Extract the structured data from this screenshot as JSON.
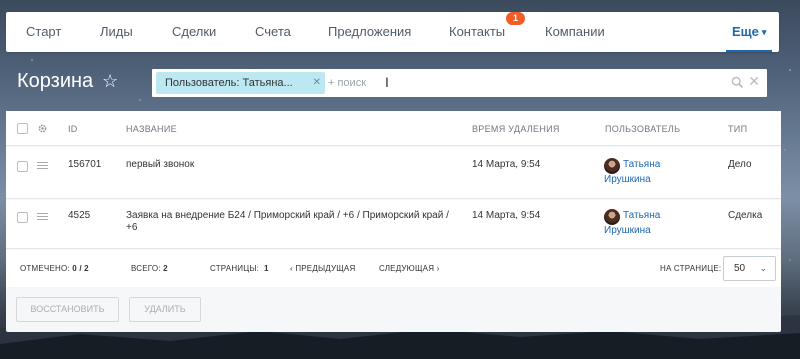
{
  "nav": {
    "items": [
      "Старт",
      "Лиды",
      "Сделки",
      "Счета",
      "Предложения",
      "Контакты",
      "Компании"
    ],
    "contacts_badge": "1",
    "more_label": "Еще"
  },
  "page": {
    "title": "Корзина"
  },
  "search": {
    "filter_chip": "Пользователь: Татьяна...",
    "add_label": "+ поиск"
  },
  "table": {
    "headers": {
      "id": "ID",
      "name": "НАЗВАНИЕ",
      "deleted": "ВРЕМЯ УДАЛЕНИЯ",
      "user": "ПОЛЬЗОВАТЕЛЬ",
      "type": "ТИП"
    },
    "rows": [
      {
        "id": "156701",
        "name": "первый звонок",
        "deleted": "14 Марта, 9:54",
        "user_first": "Татьяна",
        "user_last": "Ирушкина",
        "type": "Дело"
      },
      {
        "id": "4525",
        "name": "Заявка на внедрение Б24 / Приморский край / +6 / Приморский край / +6",
        "deleted": "14 Марта, 9:54",
        "user_first": "Татьяна",
        "user_last": "Ирушкина",
        "type": "Сделка"
      }
    ]
  },
  "footer": {
    "selected_label": "ОТМЕЧЕНО:",
    "selected_value": "0 / 2",
    "total_label": "ВСЕГО:",
    "total_value": "2",
    "pages_label": "СТРАНИЦЫ:",
    "pages_value": "1",
    "prev_label": "ПРЕДЫДУЩАЯ",
    "next_label": "СЛЕДУЮЩАЯ",
    "per_page_label": "НА СТРАНИЦЕ:",
    "per_page_value": "50"
  },
  "actions": {
    "restore_label": "ВОССТАНОВИТЬ",
    "delete_label": "УДАЛИТЬ"
  },
  "colors": {
    "accent": "#2067b0",
    "badge": "#f25c27",
    "chip": "#bce8f1"
  }
}
